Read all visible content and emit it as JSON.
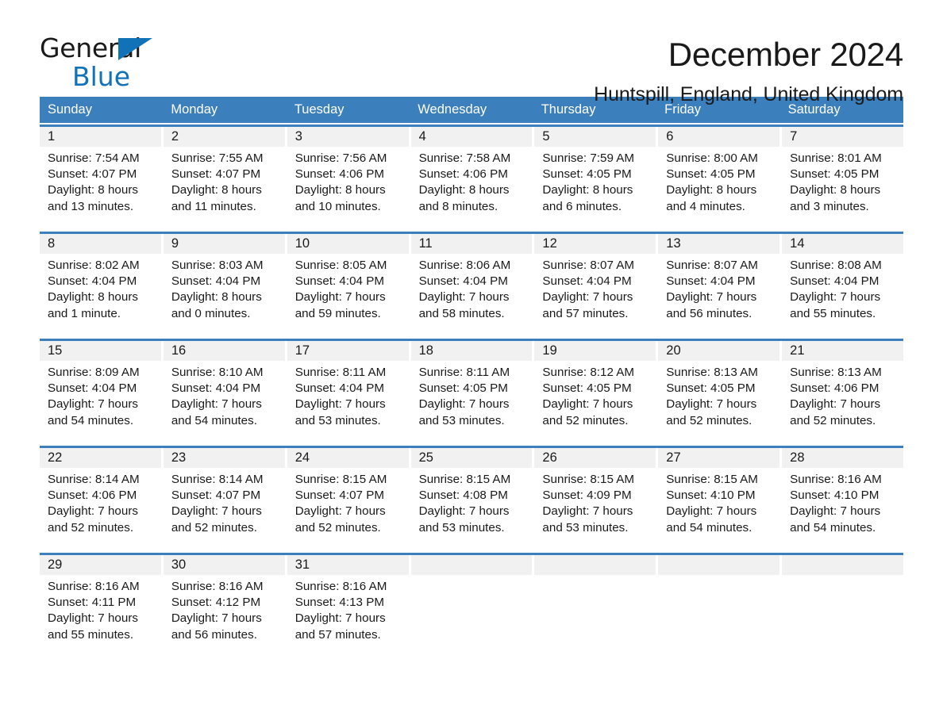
{
  "brand": {
    "name_part1": "General",
    "name_part2": "Blue",
    "accent_color": "#1272b8"
  },
  "header": {
    "title": "December 2024",
    "subtitle": "Huntspill, England, United Kingdom",
    "header_bg_color": "#3c7fbd",
    "daynum_bg_color": "#f1f1f1"
  },
  "weekdays": [
    "Sunday",
    "Monday",
    "Tuesday",
    "Wednesday",
    "Thursday",
    "Friday",
    "Saturday"
  ],
  "weeks": [
    [
      {
        "day": "1",
        "sunrise": "Sunrise: 7:54 AM",
        "sunset": "Sunset: 4:07 PM",
        "daylight1": "Daylight: 8 hours",
        "daylight2": "and 13 minutes."
      },
      {
        "day": "2",
        "sunrise": "Sunrise: 7:55 AM",
        "sunset": "Sunset: 4:07 PM",
        "daylight1": "Daylight: 8 hours",
        "daylight2": "and 11 minutes."
      },
      {
        "day": "3",
        "sunrise": "Sunrise: 7:56 AM",
        "sunset": "Sunset: 4:06 PM",
        "daylight1": "Daylight: 8 hours",
        "daylight2": "and 10 minutes."
      },
      {
        "day": "4",
        "sunrise": "Sunrise: 7:58 AM",
        "sunset": "Sunset: 4:06 PM",
        "daylight1": "Daylight: 8 hours",
        "daylight2": "and 8 minutes."
      },
      {
        "day": "5",
        "sunrise": "Sunrise: 7:59 AM",
        "sunset": "Sunset: 4:05 PM",
        "daylight1": "Daylight: 8 hours",
        "daylight2": "and 6 minutes."
      },
      {
        "day": "6",
        "sunrise": "Sunrise: 8:00 AM",
        "sunset": "Sunset: 4:05 PM",
        "daylight1": "Daylight: 8 hours",
        "daylight2": "and 4 minutes."
      },
      {
        "day": "7",
        "sunrise": "Sunrise: 8:01 AM",
        "sunset": "Sunset: 4:05 PM",
        "daylight1": "Daylight: 8 hours",
        "daylight2": "and 3 minutes."
      }
    ],
    [
      {
        "day": "8",
        "sunrise": "Sunrise: 8:02 AM",
        "sunset": "Sunset: 4:04 PM",
        "daylight1": "Daylight: 8 hours",
        "daylight2": "and 1 minute."
      },
      {
        "day": "9",
        "sunrise": "Sunrise: 8:03 AM",
        "sunset": "Sunset: 4:04 PM",
        "daylight1": "Daylight: 8 hours",
        "daylight2": "and 0 minutes."
      },
      {
        "day": "10",
        "sunrise": "Sunrise: 8:05 AM",
        "sunset": "Sunset: 4:04 PM",
        "daylight1": "Daylight: 7 hours",
        "daylight2": "and 59 minutes."
      },
      {
        "day": "11",
        "sunrise": "Sunrise: 8:06 AM",
        "sunset": "Sunset: 4:04 PM",
        "daylight1": "Daylight: 7 hours",
        "daylight2": "and 58 minutes."
      },
      {
        "day": "12",
        "sunrise": "Sunrise: 8:07 AM",
        "sunset": "Sunset: 4:04 PM",
        "daylight1": "Daylight: 7 hours",
        "daylight2": "and 57 minutes."
      },
      {
        "day": "13",
        "sunrise": "Sunrise: 8:07 AM",
        "sunset": "Sunset: 4:04 PM",
        "daylight1": "Daylight: 7 hours",
        "daylight2": "and 56 minutes."
      },
      {
        "day": "14",
        "sunrise": "Sunrise: 8:08 AM",
        "sunset": "Sunset: 4:04 PM",
        "daylight1": "Daylight: 7 hours",
        "daylight2": "and 55 minutes."
      }
    ],
    [
      {
        "day": "15",
        "sunrise": "Sunrise: 8:09 AM",
        "sunset": "Sunset: 4:04 PM",
        "daylight1": "Daylight: 7 hours",
        "daylight2": "and 54 minutes."
      },
      {
        "day": "16",
        "sunrise": "Sunrise: 8:10 AM",
        "sunset": "Sunset: 4:04 PM",
        "daylight1": "Daylight: 7 hours",
        "daylight2": "and 54 minutes."
      },
      {
        "day": "17",
        "sunrise": "Sunrise: 8:11 AM",
        "sunset": "Sunset: 4:04 PM",
        "daylight1": "Daylight: 7 hours",
        "daylight2": "and 53 minutes."
      },
      {
        "day": "18",
        "sunrise": "Sunrise: 8:11 AM",
        "sunset": "Sunset: 4:05 PM",
        "daylight1": "Daylight: 7 hours",
        "daylight2": "and 53 minutes."
      },
      {
        "day": "19",
        "sunrise": "Sunrise: 8:12 AM",
        "sunset": "Sunset: 4:05 PM",
        "daylight1": "Daylight: 7 hours",
        "daylight2": "and 52 minutes."
      },
      {
        "day": "20",
        "sunrise": "Sunrise: 8:13 AM",
        "sunset": "Sunset: 4:05 PM",
        "daylight1": "Daylight: 7 hours",
        "daylight2": "and 52 minutes."
      },
      {
        "day": "21",
        "sunrise": "Sunrise: 8:13 AM",
        "sunset": "Sunset: 4:06 PM",
        "daylight1": "Daylight: 7 hours",
        "daylight2": "and 52 minutes."
      }
    ],
    [
      {
        "day": "22",
        "sunrise": "Sunrise: 8:14 AM",
        "sunset": "Sunset: 4:06 PM",
        "daylight1": "Daylight: 7 hours",
        "daylight2": "and 52 minutes."
      },
      {
        "day": "23",
        "sunrise": "Sunrise: 8:14 AM",
        "sunset": "Sunset: 4:07 PM",
        "daylight1": "Daylight: 7 hours",
        "daylight2": "and 52 minutes."
      },
      {
        "day": "24",
        "sunrise": "Sunrise: 8:15 AM",
        "sunset": "Sunset: 4:07 PM",
        "daylight1": "Daylight: 7 hours",
        "daylight2": "and 52 minutes."
      },
      {
        "day": "25",
        "sunrise": "Sunrise: 8:15 AM",
        "sunset": "Sunset: 4:08 PM",
        "daylight1": "Daylight: 7 hours",
        "daylight2": "and 53 minutes."
      },
      {
        "day": "26",
        "sunrise": "Sunrise: 8:15 AM",
        "sunset": "Sunset: 4:09 PM",
        "daylight1": "Daylight: 7 hours",
        "daylight2": "and 53 minutes."
      },
      {
        "day": "27",
        "sunrise": "Sunrise: 8:15 AM",
        "sunset": "Sunset: 4:10 PM",
        "daylight1": "Daylight: 7 hours",
        "daylight2": "and 54 minutes."
      },
      {
        "day": "28",
        "sunrise": "Sunrise: 8:16 AM",
        "sunset": "Sunset: 4:10 PM",
        "daylight1": "Daylight: 7 hours",
        "daylight2": "and 54 minutes."
      }
    ],
    [
      {
        "day": "29",
        "sunrise": "Sunrise: 8:16 AM",
        "sunset": "Sunset: 4:11 PM",
        "daylight1": "Daylight: 7 hours",
        "daylight2": "and 55 minutes."
      },
      {
        "day": "30",
        "sunrise": "Sunrise: 8:16 AM",
        "sunset": "Sunset: 4:12 PM",
        "daylight1": "Daylight: 7 hours",
        "daylight2": "and 56 minutes."
      },
      {
        "day": "31",
        "sunrise": "Sunrise: 8:16 AM",
        "sunset": "Sunset: 4:13 PM",
        "daylight1": "Daylight: 7 hours",
        "daylight2": "and 57 minutes."
      },
      {
        "day": "",
        "sunrise": "",
        "sunset": "",
        "daylight1": "",
        "daylight2": ""
      },
      {
        "day": "",
        "sunrise": "",
        "sunset": "",
        "daylight1": "",
        "daylight2": ""
      },
      {
        "day": "",
        "sunrise": "",
        "sunset": "",
        "daylight1": "",
        "daylight2": ""
      },
      {
        "day": "",
        "sunrise": "",
        "sunset": "",
        "daylight1": "",
        "daylight2": ""
      }
    ]
  ]
}
